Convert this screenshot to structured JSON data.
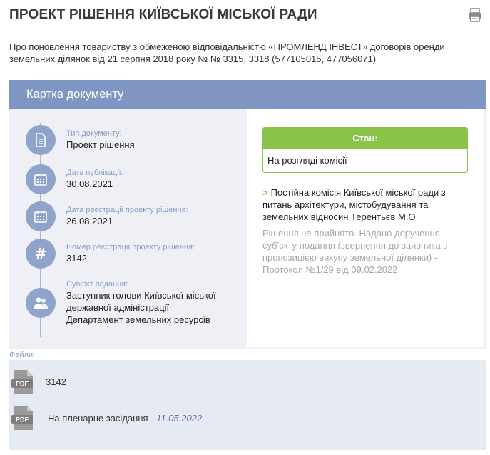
{
  "header": {
    "title": "ПРОЕКТ РІШЕННЯ КИЇВСЬКОЇ МІСЬКОЇ РАДИ",
    "print_icon": "printer-icon"
  },
  "description": "Про поновлення товариству з обмеженою відповідальністю «ПРОМЛЕНД ІНВЕСТ» договорів оренди земельних ділянок від 21 серпня 2018 року № № 3315, 3318 (577105015, 477056071)",
  "card": {
    "title": "Картка документу",
    "fields": [
      {
        "label": "Тип документу:",
        "value": "Проект рішення",
        "icon": "document-icon"
      },
      {
        "label": "Дата публікації:",
        "value": "30.08.2021",
        "icon": "calendar-icon"
      },
      {
        "label": "Дата реєстрації проекту рішення:",
        "value": "26.08.2021",
        "icon": "calendar-icon"
      },
      {
        "label": "Номер реєстрації проекту рішення:",
        "value": "3142",
        "icon": "hash-icon"
      },
      {
        "label": "Суб'єкт подання:",
        "value_lines": [
          "Заступник голови Київської міської",
          "державної адміністрації",
          "Департамент земельних ресурсів"
        ],
        "icon": "people-icon"
      }
    ],
    "status": {
      "label": "Стан:",
      "value": "На розгляді комісії"
    },
    "committee": {
      "marker": ">",
      "text": "Постійна комісія Київської міської ради з питань архітектури, містобудування та земельних відносин Терентьєв М.О"
    },
    "decision": "Рішення не прийнято. Надано доручення суб'єкту подання (звернення до заявника з пропозицією викупу земельної ділянки) - Протокол №1/29 від 09.02.2022"
  },
  "files": {
    "label": "Файли:",
    "items": [
      {
        "icon_text": "PDF",
        "name": "3142",
        "date": ""
      },
      {
        "icon_text": "PDF",
        "name": "На пленарне засідання - ",
        "date": "11.05.2022"
      }
    ]
  },
  "colors": {
    "card_header": "#7f96c2",
    "timeline_icon": "#8fa3cb",
    "status_green": "#8bc34a",
    "field_label": "#8a9cc4"
  }
}
